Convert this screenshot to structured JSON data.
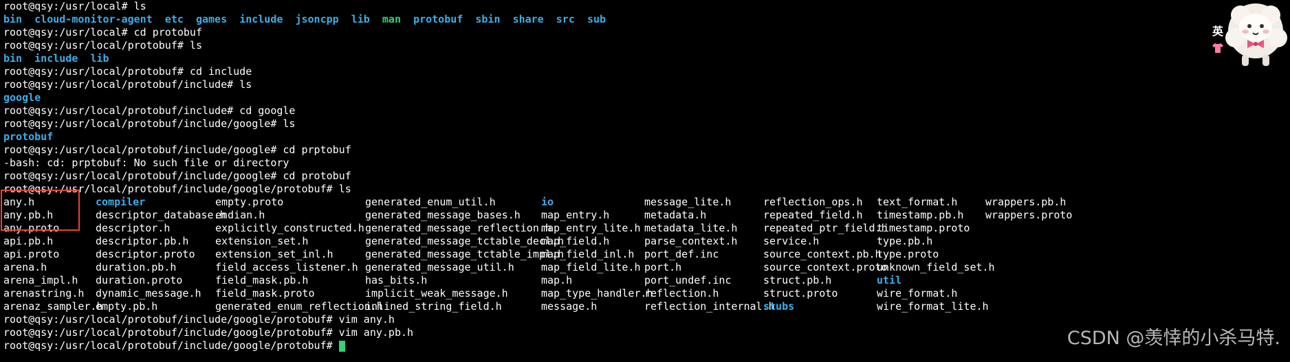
{
  "terminal": {
    "lines": [
      {
        "type": "cmd",
        "prompt": "root@qsy:/usr/local# ",
        "command": "ls"
      },
      {
        "type": "ls",
        "items": [
          {
            "name": "bin",
            "kind": "dir"
          },
          {
            "name": "cloud-monitor-agent",
            "kind": "dir"
          },
          {
            "name": "etc",
            "kind": "dir"
          },
          {
            "name": "games",
            "kind": "dir"
          },
          {
            "name": "include",
            "kind": "dir"
          },
          {
            "name": "jsoncpp",
            "kind": "dir"
          },
          {
            "name": "lib",
            "kind": "dir"
          },
          {
            "name": "man",
            "kind": "exe"
          },
          {
            "name": "protobuf",
            "kind": "dir"
          },
          {
            "name": "sbin",
            "kind": "dir"
          },
          {
            "name": "share",
            "kind": "dir"
          },
          {
            "name": "src",
            "kind": "dir"
          },
          {
            "name": "sub",
            "kind": "dir"
          }
        ]
      },
      {
        "type": "cmd",
        "prompt": "root@qsy:/usr/local# ",
        "command": "cd protobuf"
      },
      {
        "type": "cmd",
        "prompt": "root@qsy:/usr/local/protobuf# ",
        "command": "ls"
      },
      {
        "type": "ls",
        "items": [
          {
            "name": "bin",
            "kind": "dir"
          },
          {
            "name": "include",
            "kind": "dir"
          },
          {
            "name": "lib",
            "kind": "dir"
          }
        ]
      },
      {
        "type": "cmd",
        "prompt": "root@qsy:/usr/local/protobuf# ",
        "command": "cd include"
      },
      {
        "type": "cmd",
        "prompt": "root@qsy:/usr/local/protobuf/include# ",
        "command": "ls"
      },
      {
        "type": "ls",
        "items": [
          {
            "name": "google",
            "kind": "dir"
          }
        ]
      },
      {
        "type": "cmd",
        "prompt": "root@qsy:/usr/local/protobuf/include# ",
        "command": "cd google"
      },
      {
        "type": "cmd",
        "prompt": "root@qsy:/usr/local/protobuf/include/google# ",
        "command": "ls"
      },
      {
        "type": "ls",
        "items": [
          {
            "name": "protobuf",
            "kind": "dir"
          }
        ]
      },
      {
        "type": "cmd",
        "prompt": "root@qsy:/usr/local/protobuf/include/google# ",
        "command": "cd prptobuf"
      },
      {
        "type": "text",
        "text": "-bash: cd: prptobuf: No such file or directory"
      },
      {
        "type": "cmd",
        "prompt": "root@qsy:/usr/local/protobuf/include/google# ",
        "command": "cd protobuf"
      },
      {
        "type": "cmd",
        "prompt": "root@qsy:/usr/local/protobuf/include/google/protobuf# ",
        "command": "ls"
      }
    ],
    "listing": {
      "columns": [
        [
          {
            "name": "any.h",
            "kind": "file"
          },
          {
            "name": "any.pb.h",
            "kind": "file"
          },
          {
            "name": "any.proto",
            "kind": "file"
          },
          {
            "name": "api.pb.h",
            "kind": "file"
          },
          {
            "name": "api.proto",
            "kind": "file"
          },
          {
            "name": "arena.h",
            "kind": "file"
          },
          {
            "name": "arena_impl.h",
            "kind": "file"
          },
          {
            "name": "arenastring.h",
            "kind": "file"
          },
          {
            "name": "arenaz_sampler.h",
            "kind": "file"
          }
        ],
        [
          {
            "name": "compiler",
            "kind": "dir"
          },
          {
            "name": "descriptor_database.h",
            "kind": "file"
          },
          {
            "name": "descriptor.h",
            "kind": "file"
          },
          {
            "name": "descriptor.pb.h",
            "kind": "file"
          },
          {
            "name": "descriptor.proto",
            "kind": "file"
          },
          {
            "name": "duration.pb.h",
            "kind": "file"
          },
          {
            "name": "duration.proto",
            "kind": "file"
          },
          {
            "name": "dynamic_message.h",
            "kind": "file"
          },
          {
            "name": "empty.pb.h",
            "kind": "file"
          }
        ],
        [
          {
            "name": "empty.proto",
            "kind": "file"
          },
          {
            "name": "endian.h",
            "kind": "file"
          },
          {
            "name": "explicitly_constructed.h",
            "kind": "file"
          },
          {
            "name": "extension_set.h",
            "kind": "file"
          },
          {
            "name": "extension_set_inl.h",
            "kind": "file"
          },
          {
            "name": "field_access_listener.h",
            "kind": "file"
          },
          {
            "name": "field_mask.pb.h",
            "kind": "file"
          },
          {
            "name": "field_mask.proto",
            "kind": "file"
          },
          {
            "name": "generated_enum_reflection.h",
            "kind": "file"
          }
        ],
        [
          {
            "name": "generated_enum_util.h",
            "kind": "file"
          },
          {
            "name": "generated_message_bases.h",
            "kind": "file"
          },
          {
            "name": "generated_message_reflection.h",
            "kind": "file"
          },
          {
            "name": "generated_message_tctable_decl.h",
            "kind": "file"
          },
          {
            "name": "generated_message_tctable_impl.h",
            "kind": "file"
          },
          {
            "name": "generated_message_util.h",
            "kind": "file"
          },
          {
            "name": "has_bits.h",
            "kind": "file"
          },
          {
            "name": "implicit_weak_message.h",
            "kind": "file"
          },
          {
            "name": "inlined_string_field.h",
            "kind": "file"
          }
        ],
        [
          {
            "name": "io",
            "kind": "dir"
          },
          {
            "name": "map_entry.h",
            "kind": "file"
          },
          {
            "name": "map_entry_lite.h",
            "kind": "file"
          },
          {
            "name": "map_field.h",
            "kind": "file"
          },
          {
            "name": "map_field_inl.h",
            "kind": "file"
          },
          {
            "name": "map_field_lite.h",
            "kind": "file"
          },
          {
            "name": "map.h",
            "kind": "file"
          },
          {
            "name": "map_type_handler.h",
            "kind": "file"
          },
          {
            "name": "message.h",
            "kind": "file"
          }
        ],
        [
          {
            "name": "message_lite.h",
            "kind": "file"
          },
          {
            "name": "metadata.h",
            "kind": "file"
          },
          {
            "name": "metadata_lite.h",
            "kind": "file"
          },
          {
            "name": "parse_context.h",
            "kind": "file"
          },
          {
            "name": "port_def.inc",
            "kind": "file"
          },
          {
            "name": "port.h",
            "kind": "file"
          },
          {
            "name": "port_undef.inc",
            "kind": "file"
          },
          {
            "name": "reflection.h",
            "kind": "file"
          },
          {
            "name": "reflection_internal.h",
            "kind": "file"
          }
        ],
        [
          {
            "name": "reflection_ops.h",
            "kind": "file"
          },
          {
            "name": "repeated_field.h",
            "kind": "file"
          },
          {
            "name": "repeated_ptr_field.h",
            "kind": "file"
          },
          {
            "name": "service.h",
            "kind": "file"
          },
          {
            "name": "source_context.pb.h",
            "kind": "file"
          },
          {
            "name": "source_context.proto",
            "kind": "file"
          },
          {
            "name": "struct.pb.h",
            "kind": "file"
          },
          {
            "name": "struct.proto",
            "kind": "file"
          },
          {
            "name": "stubs",
            "kind": "dir"
          }
        ],
        [
          {
            "name": "text_format.h",
            "kind": "file"
          },
          {
            "name": "timestamp.pb.h",
            "kind": "file"
          },
          {
            "name": "timestamp.proto",
            "kind": "file"
          },
          {
            "name": "type.pb.h",
            "kind": "file"
          },
          {
            "name": "type.proto",
            "kind": "file"
          },
          {
            "name": "unknown_field_set.h",
            "kind": "file"
          },
          {
            "name": "util",
            "kind": "dir"
          },
          {
            "name": "wire_format.h",
            "kind": "file"
          },
          {
            "name": "wire_format_lite.h",
            "kind": "file"
          }
        ],
        [
          {
            "name": "wrappers.pb.h",
            "kind": "file"
          },
          {
            "name": "wrappers.proto",
            "kind": "file"
          }
        ]
      ]
    },
    "after": [
      {
        "type": "cmd",
        "prompt": "root@qsy:/usr/local/protobuf/include/google/protobuf# ",
        "command": "vim any.h"
      },
      {
        "type": "cmd",
        "prompt": "root@qsy:/usr/local/protobuf/include/google/protobuf# ",
        "command": "vim any.pb.h"
      },
      {
        "type": "cursor",
        "prompt": "root@qsy:/usr/local/protobuf/include/google/protobuf# ",
        "command": ""
      }
    ]
  },
  "overlay": {
    "ime_glyph": "英",
    "watermark": "CSDN @羡悻的小杀马特."
  },
  "colors": {
    "background": "#000000",
    "text": "#ffffff",
    "directory": "#3daee9",
    "executable": "#33d17a",
    "cursor": "#33d17a",
    "highlight_box": "#e8433a"
  },
  "icons": {
    "mascot": "sheep-mascot-icon",
    "shirt": "shirt-icon"
  }
}
